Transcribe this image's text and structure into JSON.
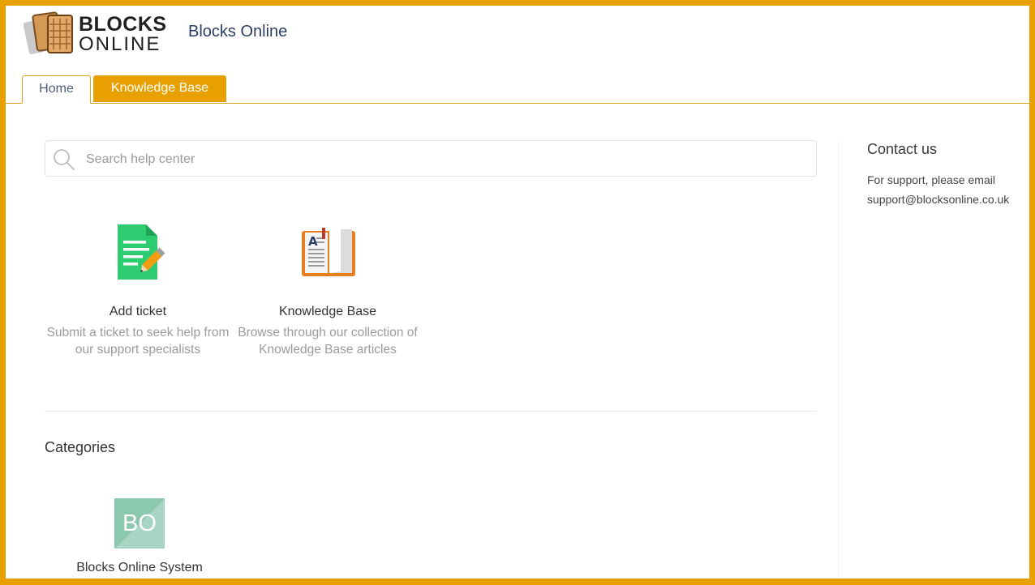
{
  "header": {
    "logo": {
      "line1": "BLOCKS",
      "line2": "ONLINE"
    },
    "site_title": "Blocks Online"
  },
  "tabs": [
    {
      "label": "Home",
      "active": false
    },
    {
      "label": "Knowledge Base",
      "active": true
    }
  ],
  "search": {
    "placeholder": "Search help center",
    "value": ""
  },
  "tiles": [
    {
      "title": "Add ticket",
      "description": "Submit a ticket to seek help from our support specialists",
      "icon": "add-ticket-icon"
    },
    {
      "title": "Knowledge Base",
      "description": "Browse through our collection of Knowledge Base articles",
      "icon": "knowledge-base-book-icon"
    }
  ],
  "categories": {
    "title": "Categories",
    "items": [
      {
        "badge": "BO",
        "name": "Blocks Online System"
      }
    ]
  },
  "contact": {
    "title": "Contact us",
    "text": "For support, please email support@blocksonline.co.uk"
  },
  "colors": {
    "accent": "#e8a000",
    "title": "#2b3f63",
    "category_badge": "#8cc7b0",
    "ticket_icon": "#2ecc71",
    "book_icon": "#e67e22"
  }
}
